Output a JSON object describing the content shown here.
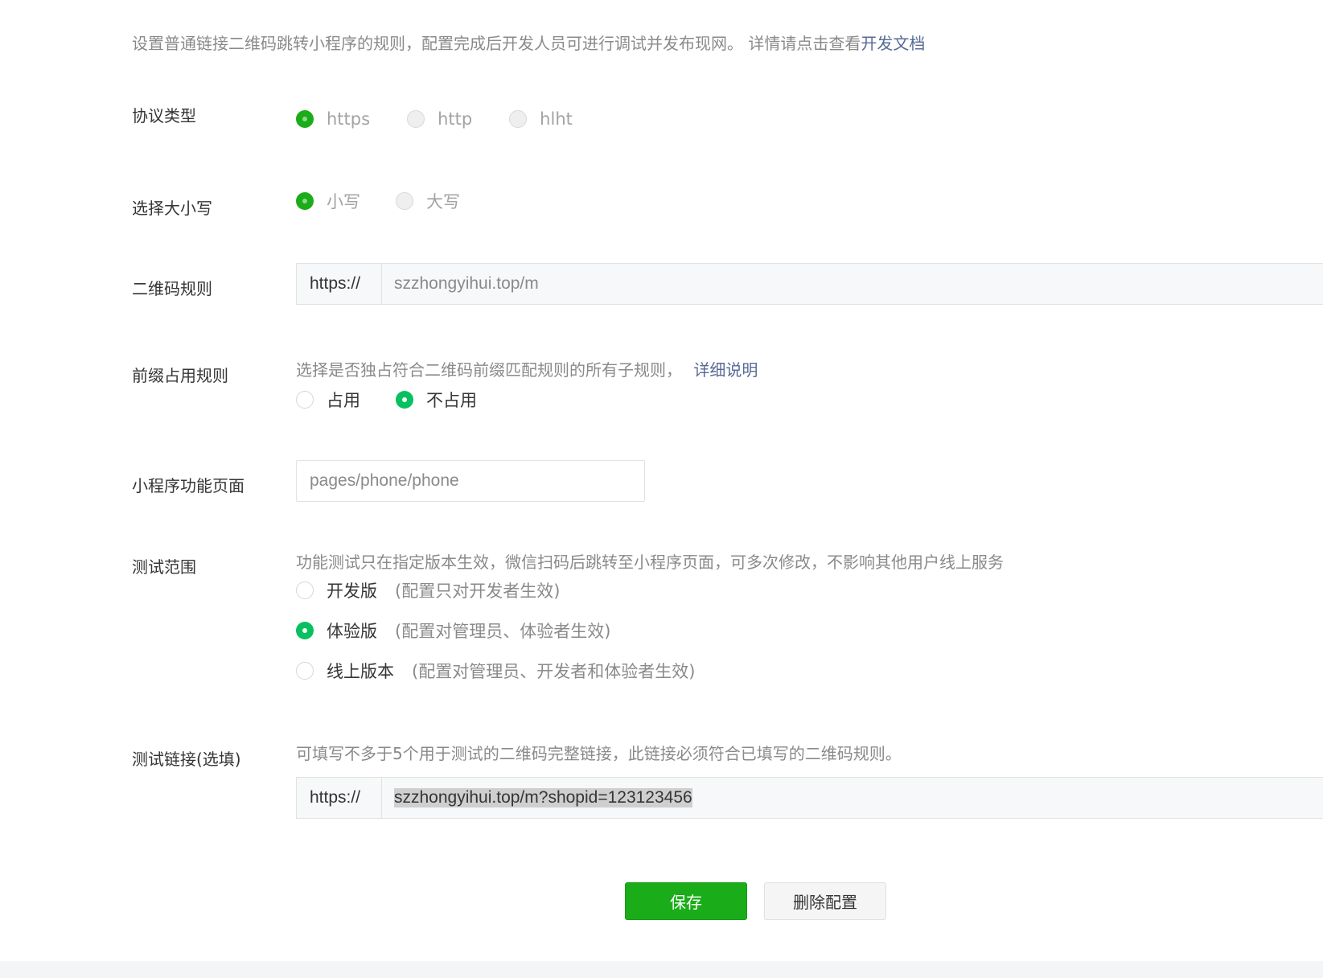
{
  "description": {
    "text": "设置普通链接二维码跳转小程序的规则，配置完成后开发人员可进行调试并发布现网。 详情请点击查看",
    "link": "开发文档"
  },
  "protocol": {
    "label": "协议类型",
    "options": [
      "https",
      "http",
      "hlht"
    ],
    "selected": "https"
  },
  "letter_case": {
    "label": "选择大小写",
    "options": [
      "小写",
      "大写"
    ],
    "selected": "小写"
  },
  "qr_rule": {
    "label": "二维码规则",
    "prefix": "https://",
    "value": "szzhongyihui.top/m"
  },
  "prefix_rule": {
    "label": "前缀占用规则",
    "hint": "选择是否独占符合二维码前缀匹配规则的所有子规则，",
    "hint_link": "详细说明",
    "options": [
      "占用",
      "不占用"
    ],
    "selected": "不占用"
  },
  "miniprogram_page": {
    "label": "小程序功能页面",
    "value": "pages/phone/phone"
  },
  "test_scope": {
    "label": "测试范围",
    "hint": "功能测试只在指定版本生效，微信扫码后跳转至小程序页面，可多次修改，不影响其他用户线上服务",
    "options": [
      {
        "label": "开发版",
        "note": "(配置只对开发者生效)"
      },
      {
        "label": "体验版",
        "note": "(配置对管理员、体验者生效)"
      },
      {
        "label": "线上版本",
        "note": "(配置对管理员、开发者和体验者生效)"
      }
    ],
    "selected": "体验版"
  },
  "test_link": {
    "label": "测试链接(选填)",
    "hint": "可填写不多于5个用于测试的二维码完整链接，此链接必须符合已填写的二维码规则。",
    "prefix": "https://",
    "value": "szzhongyihui.top/m?shopid=123123456"
  },
  "actions": {
    "save": "保存",
    "delete": "删除配置"
  },
  "colors": {
    "accent_green": "#07c160",
    "primary_button": "#1aad19",
    "link": "#576b95"
  }
}
